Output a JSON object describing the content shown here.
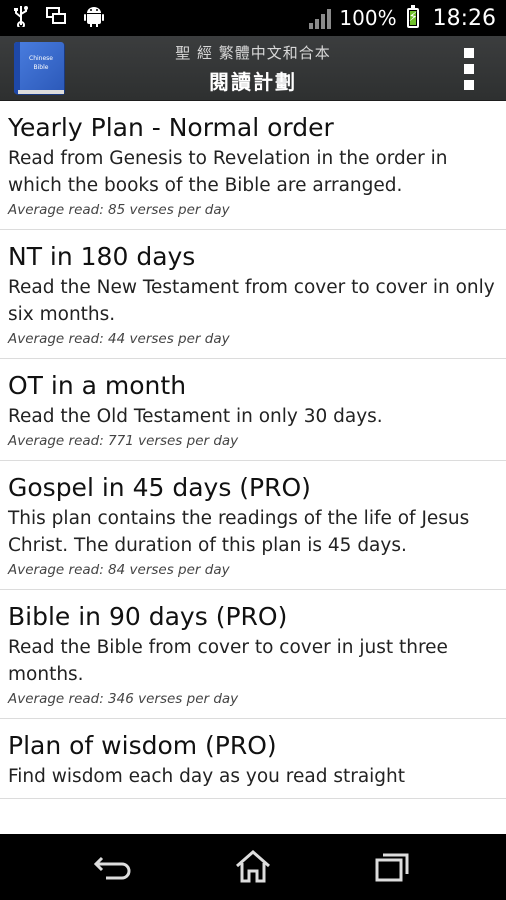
{
  "status_bar": {
    "battery": "100%",
    "time": "18:26",
    "icons": [
      "usb-icon",
      "screen-mirror-icon",
      "android-icon",
      "signal-icon",
      "battery-charging-icon"
    ]
  },
  "action_bar": {
    "subtitle": "聖 經 繁體中文和合本",
    "title": "閱讀計劃",
    "app_icon_text": "Chinese Bible"
  },
  "plans": [
    {
      "title": "Yearly Plan - Normal order",
      "description": "Read from Genesis to Revelation in the order in which the books of the Bible are arranged.",
      "average": "Average read: 85 verses per day"
    },
    {
      "title": "NT in 180 days",
      "description": "Read the New Testament from cover to cover in only six months.",
      "average": "Average read: 44 verses per day"
    },
    {
      "title": "OT in a month",
      "description": "Read the Old Testament in only 30 days.",
      "average": "Average read: 771 verses per day"
    },
    {
      "title": "Gospel in 45 days (PRO)",
      "description": "This plan contains the readings of the life of Jesus Christ. The duration of this plan is 45 days.",
      "average": "Average read: 84 verses per day"
    },
    {
      "title": "Bible in 90 days (PRO)",
      "description": "Read the Bible from cover to cover in just three months.",
      "average": "Average read: 346 verses per day"
    },
    {
      "title": "Plan of wisdom (PRO)",
      "description": "Find wisdom each day as you read straight",
      "average": ""
    }
  ],
  "nav_bar": {
    "icons": [
      "back-icon",
      "home-icon",
      "recent-apps-icon"
    ]
  }
}
